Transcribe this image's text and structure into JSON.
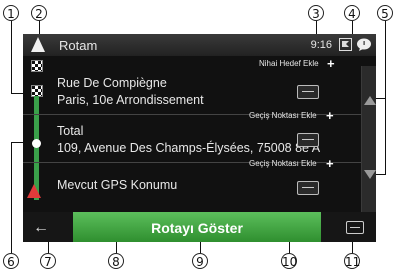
{
  "callouts": [
    "1",
    "2",
    "3",
    "4",
    "5",
    "6",
    "7",
    "8",
    "9",
    "10",
    "11"
  ],
  "screen": {
    "title": "Rotam",
    "time": "9:16",
    "final_destination_label": "Nihai Hedef Ekle",
    "waypoints": [
      {
        "line1": "Rue De Compiègne",
        "line2": "Paris, 10e Arrondissement"
      },
      {
        "line1": "Total",
        "line2": "109, Avenue Des Champs-Élysées, 75008 8e A"
      },
      {
        "line1": "Mevcut GPS Konumu",
        "line2": ""
      }
    ],
    "add_waypoint_label": "Geçiş Noktası Ekle",
    "plus": "+",
    "go_button": "Rotayı Göster",
    "back_symbol": "←"
  }
}
